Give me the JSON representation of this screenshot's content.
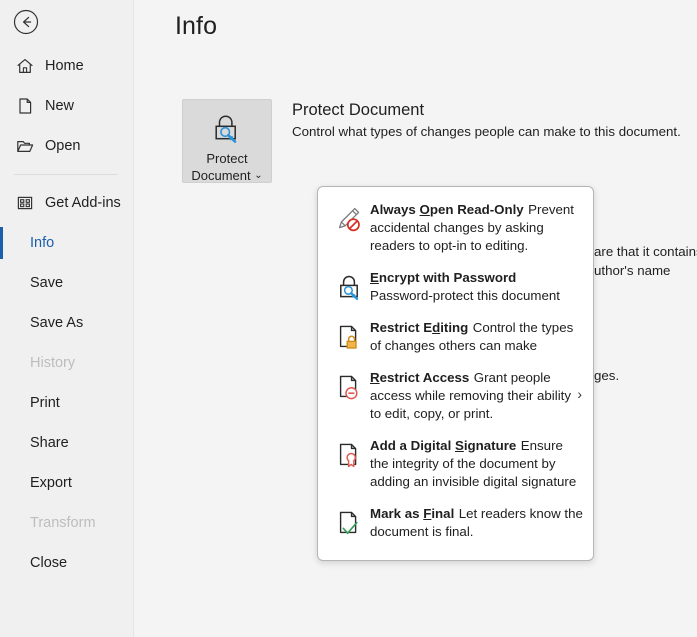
{
  "window": {
    "back_label": "Back",
    "back_icon": "back-arrow-circle-icon"
  },
  "sidebar": {
    "items": [
      {
        "label": "Home",
        "icon": "home-icon",
        "state": "normal",
        "has_icon": true
      },
      {
        "label": "New",
        "icon": "new-page-icon",
        "state": "normal",
        "has_icon": true
      },
      {
        "label": "Open",
        "icon": "open-folder-icon",
        "state": "normal",
        "has_icon": true
      },
      {
        "label": "Get Add-ins",
        "icon": "add-ins-grid-icon",
        "state": "normal",
        "has_icon": true
      },
      {
        "label": "Info",
        "icon": "",
        "state": "selected",
        "has_icon": false
      },
      {
        "label": "Save",
        "icon": "",
        "state": "normal",
        "has_icon": false
      },
      {
        "label": "Save As",
        "icon": "",
        "state": "normal",
        "has_icon": false
      },
      {
        "label": "History",
        "icon": "",
        "state": "disabled",
        "has_icon": false
      },
      {
        "label": "Print",
        "icon": "",
        "state": "normal",
        "has_icon": false
      },
      {
        "label": "Share",
        "icon": "",
        "state": "normal",
        "has_icon": false
      },
      {
        "label": "Export",
        "icon": "",
        "state": "normal",
        "has_icon": false
      },
      {
        "label": "Transform",
        "icon": "",
        "state": "disabled",
        "has_icon": false
      },
      {
        "label": "Close",
        "icon": "",
        "state": "normal",
        "has_icon": false
      }
    ]
  },
  "main": {
    "page_title": "Info",
    "protect_button": {
      "line1": "Protect",
      "line2": "Document",
      "caret": "⌄",
      "icon": "lock-with-key-icon"
    },
    "protect_section": {
      "heading": "Protect Document",
      "description": "Control what types of changes people can make to this document."
    },
    "background_text": {
      "line1": "are that it contains:",
      "line2": "uthor's name",
      "line3": "ges."
    }
  },
  "menu": {
    "items": [
      {
        "title_before": "Always ",
        "title_key": "O",
        "title_after": "pen Read-Only",
        "title_full": "Always Open Read-Only",
        "desc": "Prevent accidental changes by asking readers to opt-in to editing.",
        "icon": "pencil-no-entry-icon",
        "submenu": false
      },
      {
        "title_before": "",
        "title_key": "E",
        "title_after": "ncrypt with Password",
        "title_full": "Encrypt with Password",
        "desc": "Password-protect this document",
        "icon": "padlock-key-icon",
        "submenu": false
      },
      {
        "title_before": "Restrict E",
        "title_key": "d",
        "title_after": "iting",
        "title_full": "Restrict Editing",
        "desc": "Control the types of changes others can make",
        "icon": "document-orange-lock-icon",
        "submenu": false
      },
      {
        "title_before": "",
        "title_key": "R",
        "title_after": "estrict Access",
        "title_full": "Restrict Access",
        "desc": "Grant people access while removing their ability to edit, copy, or print.",
        "icon": "document-red-block-icon",
        "submenu": true,
        "submenu_arrow": "›"
      },
      {
        "title_before": "Add a Digital ",
        "title_key": "S",
        "title_after": "ignature",
        "title_full": "Add a Digital Signature",
        "desc": "Ensure the integrity of the document by adding an invisible digital signature",
        "icon": "document-red-ribbon-icon",
        "submenu": false
      },
      {
        "title_before": "Mark as ",
        "title_key": "F",
        "title_after": "inal",
        "title_full": "Mark as Final",
        "desc": "Let readers know the document is final.",
        "icon": "document-green-check-icon",
        "submenu": false
      }
    ]
  },
  "colors": {
    "accent": "#1b5eab",
    "sidebar_bg": "#f0f0f0",
    "content_bg": "#f4f4f4",
    "menu_bg": "#ffffff",
    "red": "#d93025",
    "orange": "#e8a33d",
    "green": "#3a9c5a",
    "blue_key": "#2b93d6"
  }
}
